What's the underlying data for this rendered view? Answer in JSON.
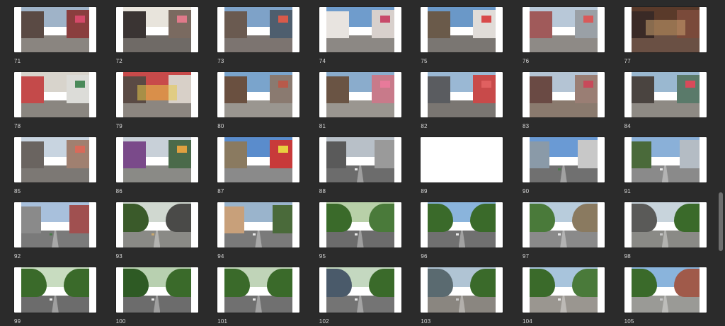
{
  "browser": {
    "title": "",
    "items": [
      {
        "label": "71",
        "scene": "street",
        "sky": "#9fb3c8",
        "ground": "#8a8580",
        "left": "#5a4a44",
        "right": "#8a3e3e",
        "accent": "#d44a6a"
      },
      {
        "label": "72",
        "scene": "street",
        "sky": "#e8e4dc",
        "ground": "#6f6a66",
        "left": "#3a3433",
        "right": "#7a6a60",
        "accent": "#e07a8a"
      },
      {
        "label": "73",
        "scene": "street",
        "sky": "#7ea2c8",
        "ground": "#7c7470",
        "left": "#6a5a50",
        "right": "#4e5e6e",
        "accent": "#d85a4a"
      },
      {
        "label": "74",
        "scene": "street",
        "sky": "#6f9ccc",
        "ground": "#8c8884",
        "left": "#e8e4e0",
        "right": "#d8d0cc",
        "accent": "#c84a6a"
      },
      {
        "label": "75",
        "scene": "street",
        "sky": "#6a98c8",
        "ground": "#7a7672",
        "left": "#6a5a4a",
        "right": "#e0dcd8",
        "accent": "#d84a4a"
      },
      {
        "label": "76",
        "scene": "street",
        "sky": "#b8c8d8",
        "ground": "#8e8a86",
        "left": "#a05a5a",
        "right": "#9aa0a6",
        "accent": "#d85a5a"
      },
      {
        "label": "77",
        "scene": "shop",
        "sky": "#5a3a2a",
        "ground": "#6a5044",
        "left": "#3a2a26",
        "right": "#7a4a3a",
        "accent": "#c8a070"
      },
      {
        "label": "78",
        "scene": "street",
        "sky": "#d8d4cc",
        "ground": "#8a8680",
        "left": "#c44a4a",
        "right": "#dcdcd8",
        "accent": "#4a8a5a"
      },
      {
        "label": "79",
        "scene": "shop",
        "sky": "#c84a4a",
        "ground": "#8c8680",
        "left": "#5a4a44",
        "right": "#d8d0c8",
        "accent": "#e8c84a"
      },
      {
        "label": "80",
        "scene": "street",
        "sky": "#7aa4cc",
        "ground": "#9a9690",
        "left": "#6a5040",
        "right": "#8a7a70",
        "accent": "#b85a4a"
      },
      {
        "label": "81",
        "scene": "street",
        "sky": "#8aaccc",
        "ground": "#9a9690",
        "left": "#6a5444",
        "right": "#c87a8a",
        "accent": "#e87a9a"
      },
      {
        "label": "82",
        "scene": "street",
        "sky": "#9ab8d4",
        "ground": "#7a7672",
        "left": "#5a5c60",
        "right": "#c84a4a",
        "accent": "#e06060"
      },
      {
        "label": "83",
        "scene": "street",
        "sky": "#b4c4d4",
        "ground": "#8a7a6e",
        "left": "#6a4a44",
        "right": "#9a7e74",
        "accent": "#c84a5a"
      },
      {
        "label": "84",
        "scene": "street",
        "sky": "#9ab8d0",
        "ground": "#8e8a84",
        "left": "#4a4440",
        "right": "#5a7a6a",
        "accent": "#d84a5a"
      },
      {
        "label": "85",
        "scene": "street",
        "sky": "#c8d4e0",
        "ground": "#7c7874",
        "left": "#6a6460",
        "right": "#a08070",
        "accent": "#d86a5a"
      },
      {
        "label": "86",
        "scene": "street",
        "sky": "#c8d0d8",
        "ground": "#8a8a86",
        "left": "#7a4a8a",
        "right": "#4a6a4a",
        "accent": "#e0a040"
      },
      {
        "label": "87",
        "scene": "street",
        "sky": "#5a8ccc",
        "ground": "#8a8a8a",
        "left": "#8a7a60",
        "right": "#c83a3a",
        "accent": "#e8d040"
      },
      {
        "label": "88",
        "scene": "avenue",
        "sky": "#b8c0c8",
        "ground": "#6c6c6c",
        "left": "#5a5a5a",
        "right": "#9a9a9a",
        "accent": "#e8e8e8"
      },
      {
        "label": "89",
        "scene": "blank"
      },
      {
        "label": "90",
        "scene": "avenue",
        "sky": "#6a9ad4",
        "ground": "#707070",
        "left": "#8a9aa8",
        "right": "#c8c8c8",
        "accent": "#4a7a4a"
      },
      {
        "label": "91",
        "scene": "avenue",
        "sky": "#8ab0d8",
        "ground": "#8a8a8a",
        "left": "#4a6a3a",
        "right": "#b4bcc4",
        "accent": "#e8e8e8"
      },
      {
        "label": "92",
        "scene": "avenue",
        "sky": "#a8c0dc",
        "ground": "#7a7a7a",
        "left": "#8a8a8a",
        "right": "#a05050",
        "accent": "#4a7a4a"
      },
      {
        "label": "93",
        "scene": "trees",
        "sky": "#d0d8d0",
        "ground": "#8a8a86",
        "left": "#3a5a2a",
        "right": "#4a4a48",
        "accent": "#c8a870"
      },
      {
        "label": "94",
        "scene": "avenue",
        "sky": "#9ab4cc",
        "ground": "#7a7a7a",
        "left": "#c8a07a",
        "right": "#4a6a3a",
        "accent": "#e8e8e8"
      },
      {
        "label": "95",
        "scene": "trees",
        "sky": "#b8d0a8",
        "ground": "#6c6c6c",
        "left": "#3a6a2a",
        "right": "#4a7a3a",
        "accent": "#e8e8e8"
      },
      {
        "label": "96",
        "scene": "trees",
        "sky": "#8ab4dc",
        "ground": "#707070",
        "left": "#3a6a2a",
        "right": "#3a6a2a",
        "accent": "#e8e8e8"
      },
      {
        "label": "97",
        "scene": "trees",
        "sky": "#b8ccdc",
        "ground": "#8a8a8a",
        "left": "#4a7a3a",
        "right": "#8a7a60",
        "accent": "#e8e8e8"
      },
      {
        "label": "98",
        "scene": "trees",
        "sky": "#c8d4dc",
        "ground": "#8a8a86",
        "left": "#5a5a58",
        "right": "#3a6a2a",
        "accent": "#c8c8c8"
      },
      {
        "label": "99",
        "scene": "trees",
        "sky": "#c8dcc0",
        "ground": "#6c6c6c",
        "left": "#3a6a2a",
        "right": "#3a6a2a",
        "accent": "#e8e8e8"
      },
      {
        "label": "100",
        "scene": "trees",
        "sky": "#b8d0b0",
        "ground": "#6c6c6c",
        "left": "#2e5a24",
        "right": "#3a6a2a",
        "accent": "#e8e8e8"
      },
      {
        "label": "101",
        "scene": "trees",
        "sky": "#c0d4b8",
        "ground": "#707070",
        "left": "#3a6a2a",
        "right": "#3a6a2a",
        "accent": "#e8e8e8"
      },
      {
        "label": "102",
        "scene": "trees",
        "sky": "#c4d8c0",
        "ground": "#747474",
        "left": "#4a5a6a",
        "right": "#3a6a2a",
        "accent": "#e8e8e8"
      },
      {
        "label": "103",
        "scene": "trees",
        "sky": "#b0c4d4",
        "ground": "#8a8680",
        "left": "#5a6a70",
        "right": "#3a6a2a",
        "accent": "#c8c8c8"
      },
      {
        "label": "104",
        "scene": "trees",
        "sky": "#a8c4dc",
        "ground": "#9a9690",
        "left": "#3a6a2a",
        "right": "#4a7a3a",
        "accent": "#e8e8e8"
      },
      {
        "label": "105",
        "scene": "trees",
        "sky": "#8ab4dc",
        "ground": "#9a9a96",
        "left": "#3a6a2a",
        "right": "#a05a4a",
        "accent": "#c8c8c8"
      }
    ]
  },
  "scroll": {
    "position": 0.72,
    "thumb_fraction": 0.18
  }
}
